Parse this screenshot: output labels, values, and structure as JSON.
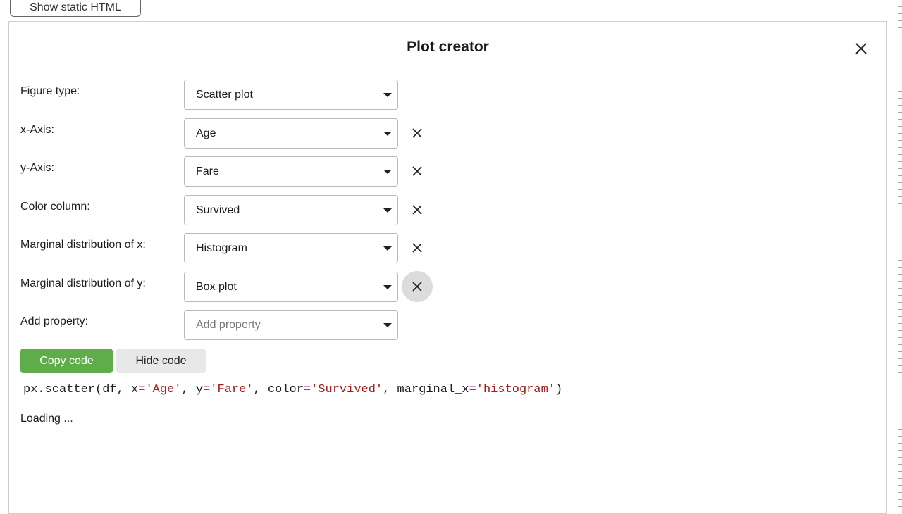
{
  "top_button": {
    "label": "Show static HTML"
  },
  "dialog": {
    "title": "Plot creator",
    "rows": [
      {
        "label": "Figure type:",
        "value": "Scatter plot"
      },
      {
        "label": "x-Axis:",
        "value": "Age"
      },
      {
        "label": "y-Axis:",
        "value": "Fare"
      },
      {
        "label": "Color column:",
        "value": "Survived"
      },
      {
        "label": "Marginal distribution of x:",
        "value": "Histogram"
      },
      {
        "label": "Marginal distribution of y:",
        "value": "Box plot"
      },
      {
        "label": "Add property:",
        "placeholder": "Add property"
      }
    ],
    "buttons": {
      "copy": "Copy code",
      "hide": "Hide code"
    },
    "code": {
      "p1": "px.scatter(df, x",
      "eq1": "=",
      "s1": "'Age'",
      "p2": ", y",
      "eq2": "=",
      "s2": "'Fare'",
      "p3": ", color",
      "eq3": "=",
      "s3": "'Survived'",
      "p4": ", marginal_x",
      "eq4": "=",
      "s4": "'histogram'",
      "p5": ")"
    },
    "status": "Loading ..."
  },
  "colors": {
    "copy_button": "#5ead4a",
    "hide_button": "#e8e8e8",
    "code_operator": "#a626a4",
    "code_string": "#a11d1d"
  }
}
